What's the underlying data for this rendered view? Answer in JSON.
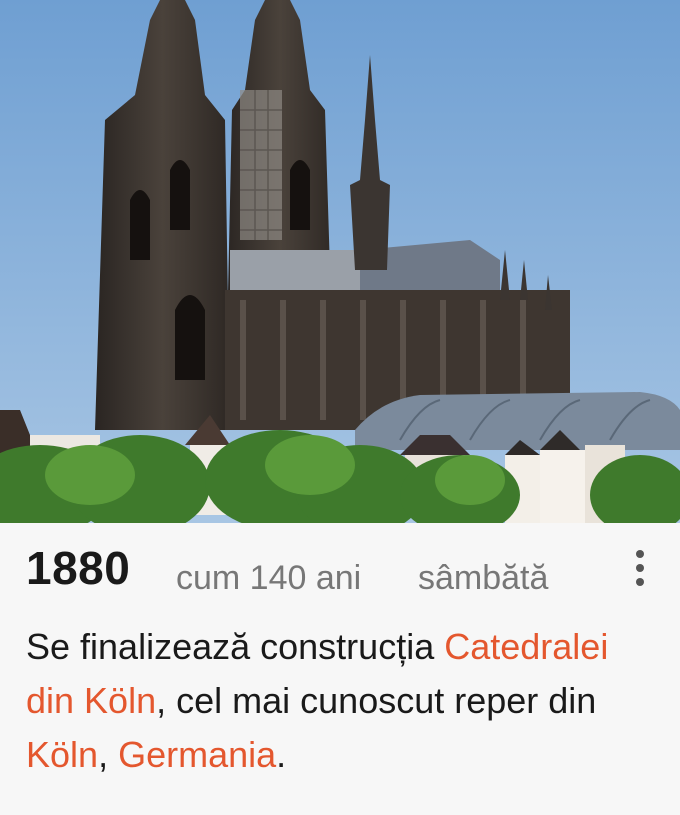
{
  "event": {
    "image_alt": "Catedrala din Köln",
    "year": "1880",
    "ago": "cum 140 ani",
    "weekday": "sâmbătă",
    "menu_icon": "more-vert-icon",
    "description": {
      "part1": "Se finalizează construcția ",
      "link1": "Catedralei din Köln",
      "part2": ", cel mai cunoscut reper din ",
      "link2": "Köln",
      "part3": ", ",
      "link3": "Germania",
      "part4": "."
    }
  },
  "colors": {
    "link": "#e4572e",
    "text": "#1a1a1a",
    "secondary": "#777777",
    "sky": "#7fa9d6"
  }
}
